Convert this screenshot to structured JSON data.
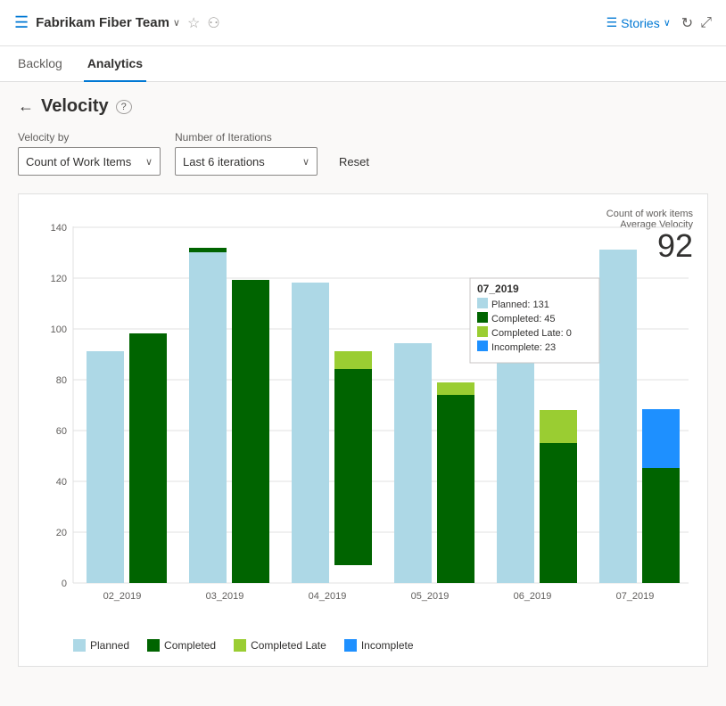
{
  "header": {
    "icon": "☰",
    "title": "Fabrikam Fiber Team",
    "chevron": "∨",
    "star": "☆",
    "team_icon": "👥",
    "stories_label": "Stories",
    "refresh_label": "↻",
    "expand_label": "⤢"
  },
  "nav": {
    "tabs": [
      {
        "id": "backlog",
        "label": "Backlog",
        "active": false
      },
      {
        "id": "analytics",
        "label": "Analytics",
        "active": true
      }
    ]
  },
  "page": {
    "title": "Velocity",
    "back_label": "←",
    "help_label": "?",
    "velocity_by_label": "Velocity by",
    "velocity_by_value": "Count of Work Items",
    "iterations_label": "Number of Iterations",
    "iterations_value": "Last 6 iterations",
    "reset_label": "Reset",
    "count_label": "Count of work items",
    "avg_velocity_label": "Average Velocity",
    "avg_velocity_value": "92"
  },
  "chart": {
    "y_max": 140,
    "y_ticks": [
      0,
      20,
      40,
      60,
      80,
      100,
      120,
      140
    ],
    "bars": [
      {
        "label": "02_2019",
        "planned": 91,
        "completed": 98,
        "completed_late": 0,
        "incomplete": 0
      },
      {
        "label": "03_2019",
        "planned": 130,
        "completed": 119,
        "completed_late": 0,
        "incomplete": 0
      },
      {
        "label": "04_2019",
        "planned": 118,
        "completed": 84,
        "completed_late": 91,
        "incomplete": 0
      },
      {
        "label": "05_2019",
        "planned": 94,
        "completed": 74,
        "completed_late": 79,
        "incomplete": 0
      },
      {
        "label": "06_2019",
        "planned": 91,
        "completed": 55,
        "completed_late": 68,
        "incomplete": 0
      },
      {
        "label": "07_2019",
        "planned": 131,
        "completed": 45,
        "completed_late": 0,
        "incomplete": 23
      }
    ],
    "tooltip": {
      "title": "07_2019",
      "rows": [
        {
          "color": "#add8e6",
          "label": "Planned: 131"
        },
        {
          "color": "#006400",
          "label": "Completed: 45"
        },
        {
          "color": "#9acd32",
          "label": "Completed Late: 0"
        },
        {
          "color": "#1e90ff",
          "label": "Incomplete: 23"
        }
      ]
    },
    "legend": [
      {
        "color": "#add8e6",
        "label": "Planned"
      },
      {
        "color": "#006400",
        "label": "Completed"
      },
      {
        "color": "#9acd32",
        "label": "Completed Late"
      },
      {
        "color": "#1e90ff",
        "label": "Incomplete"
      }
    ]
  }
}
